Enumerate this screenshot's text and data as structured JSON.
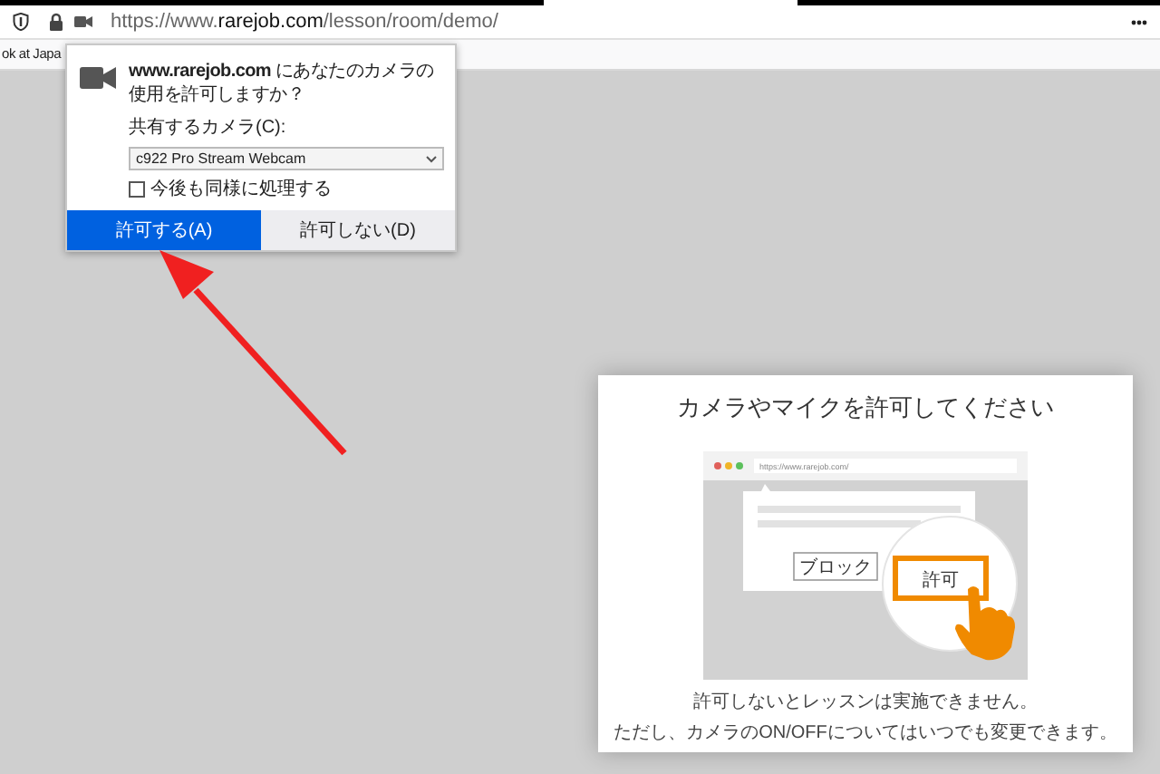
{
  "browser": {
    "url": "https://www.**rarejob.com**/lesson/room/demo/",
    "bookmark": "ok at Japa"
  },
  "permission_popup": {
    "message": "**www.rarejob.com** にあなたのカメラの使用を許可しますか？",
    "camera_label": "共有するカメラ(C):",
    "camera_select": "c922 Pro Stream Webcam",
    "remember": {
      "label": "今後も同様に処理する",
      "checked": false
    },
    "buttons": [
      {
        "label": "許可する(A)",
        "selected": true
      },
      {
        "label": "許可しない(D)",
        "selected": false
      }
    ]
  },
  "modal": {
    "title": "カメラやマイクを許可してください",
    "illustration": {
      "url": "https://www.rarejob.com/",
      "block_label": "ブロック",
      "allow_label": "許可"
    },
    "notes": [
      "許可しないとレッスンは実施できません。",
      "ただし、カメラのON/OFFについてはいつでも変更できます。"
    ]
  }
}
